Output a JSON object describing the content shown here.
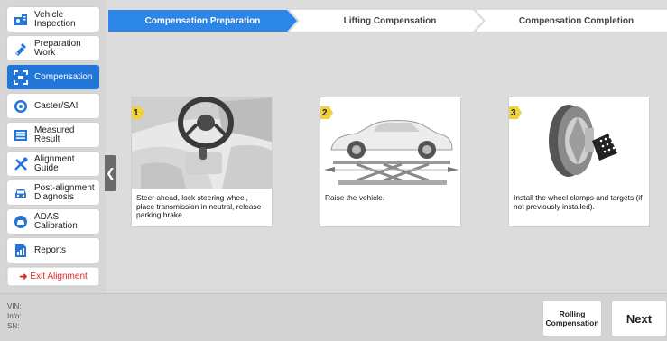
{
  "sidebar": {
    "items": [
      {
        "label": "Vehicle\nInspection",
        "icon": "vehicle-inspection-icon"
      },
      {
        "label": "Preparation\nWork",
        "icon": "preparation-icon"
      },
      {
        "label": "Compensation",
        "icon": "compensation-icon",
        "active": true
      },
      {
        "label": "Caster/SAI",
        "icon": "caster-icon"
      },
      {
        "label": "Measured\nResult",
        "icon": "measured-result-icon"
      },
      {
        "label": "Alignment\nGuide",
        "icon": "alignment-guide-icon"
      },
      {
        "label": "Post-alignment\nDiagnosis",
        "icon": "post-alignment-icon"
      },
      {
        "label": "ADAS\nCalibration",
        "icon": "adas-icon"
      },
      {
        "label": "Reports",
        "icon": "reports-icon"
      }
    ],
    "exit_label": "Exit Alignment"
  },
  "steps": [
    {
      "label": "Compensation Preparation",
      "active": true
    },
    {
      "label": "Lifting Compensation",
      "active": false
    },
    {
      "label": "Compensation Completion",
      "active": false
    }
  ],
  "cards": [
    {
      "num": "1",
      "text": "Steer ahead, lock steering wheel, place transmission in neutral, release parking brake."
    },
    {
      "num": "2",
      "text": "Raise the vehicle."
    },
    {
      "num": "3",
      "text": "Install the wheel clamps and targets (if not previously installed)."
    }
  ],
  "info": {
    "vin_label": "VIN:",
    "info_label": "Info:",
    "sn_label": "SN:"
  },
  "buttons": {
    "rolling": "Rolling Compensation",
    "next": "Next"
  },
  "colors": {
    "accent": "#2276d9",
    "step_active": "#2b86e8",
    "exit": "#e02525",
    "badge": "#f1d23a"
  }
}
